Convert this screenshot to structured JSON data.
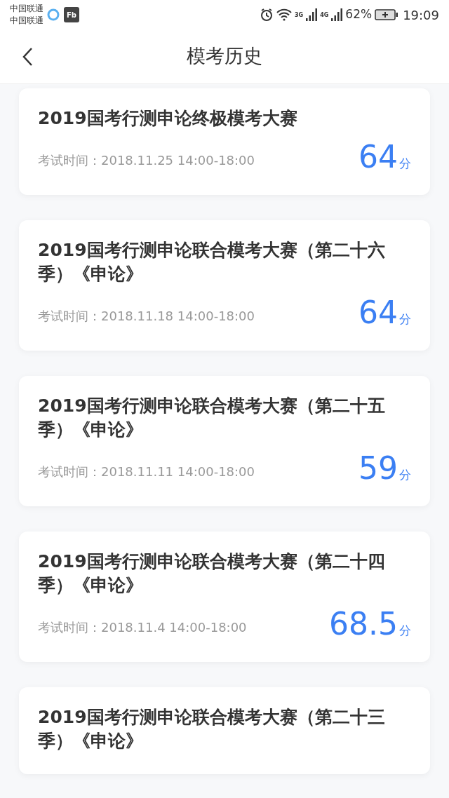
{
  "status_bar": {
    "carriers": [
      "中国联通",
      "中国联通"
    ],
    "app_badge": "Fb",
    "network_3g": "3G",
    "network_4g": "4G",
    "battery": "62%",
    "time": "19:09"
  },
  "header": {
    "title": "模考历史"
  },
  "exams": [
    {
      "title": "2019国考行测申论终极模考大赛",
      "time_label": "考试时间：",
      "time": "2018.11.25 14:00-18:00",
      "score": "64",
      "unit": "分"
    },
    {
      "title": "2019国考行测申论联合模考大赛（第二十六季）《申论》",
      "time_label": "考试时间：",
      "time": "2018.11.18 14:00-18:00",
      "score": "64",
      "unit": "分"
    },
    {
      "title": "2019国考行测申论联合模考大赛（第二十五季）《申论》",
      "time_label": "考试时间：",
      "time": "2018.11.11 14:00-18:00",
      "score": "59",
      "unit": "分"
    },
    {
      "title": "2019国考行测申论联合模考大赛（第二十四季）《申论》",
      "time_label": "考试时间：",
      "time": "2018.11.4 14:00-18:00",
      "score": "68.5",
      "unit": "分"
    },
    {
      "title": "2019国考行测申论联合模考大赛（第二十三季）《申论》"
    }
  ]
}
